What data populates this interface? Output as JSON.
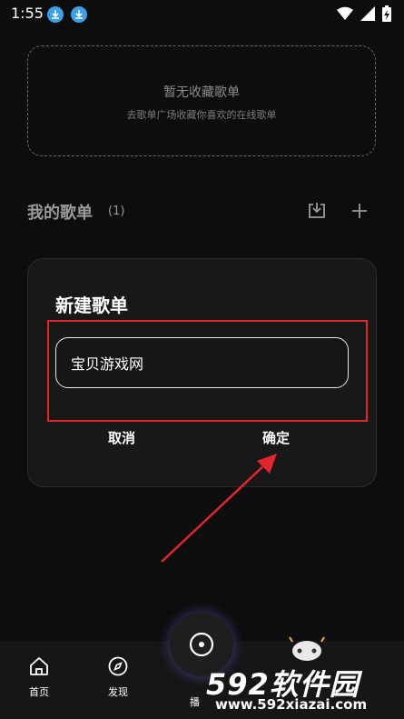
{
  "status_bar": {
    "time": "1:55",
    "icons": [
      "download-icon",
      "download-icon",
      "wifi-icon",
      "signal-icon",
      "battery-charging-icon"
    ]
  },
  "favorites_empty": {
    "title": "暂无收藏歌单",
    "subtitle": "去歌单广场收藏你喜欢的在线歌单"
  },
  "my_playlists": {
    "title": "我的歌单",
    "count": "(1)",
    "actions": [
      "import-icon",
      "plus-icon"
    ]
  },
  "dialog": {
    "title": "新建歌单",
    "input_value": "宝贝游戏网",
    "cancel_label": "取消",
    "confirm_label": "确定"
  },
  "bottom_nav": {
    "home_label": "首页",
    "discover_label": "发现",
    "play_label": "播"
  },
  "watermark": {
    "brand": "592软件园",
    "url": "www.592xiazai.com"
  },
  "colors": {
    "background": "#0d0d0d",
    "highlight": "#e3262b",
    "download_badge": "#3aa0ea"
  }
}
